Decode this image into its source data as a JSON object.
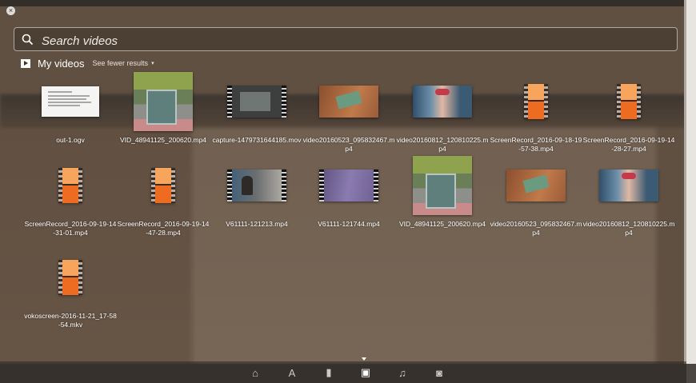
{
  "window": {
    "close_glyph": "×"
  },
  "search": {
    "placeholder": "Search videos",
    "value": ""
  },
  "category": {
    "name": "My videos",
    "toggle_label": "See fewer results",
    "toggle_chevron": "▾"
  },
  "results": [
    {
      "label": "out-1.ogv",
      "kind": "document"
    },
    {
      "label": "VID_48941125_200620.mp4",
      "kind": "photo-board"
    },
    {
      "label": "capture-1479731644185.mov",
      "kind": "screen-strip"
    },
    {
      "label": "video20160523_095832467.mp4",
      "kind": "board"
    },
    {
      "label": "video20160812_120810225.mp4",
      "kind": "child"
    },
    {
      "label": "ScreenRecord_2016-09-18-19-57-38.mp4",
      "kind": "film"
    },
    {
      "label": "ScreenRecord_2016-09-19-14-28-27.mp4",
      "kind": "film"
    },
    {
      "label": "ScreenRecord_2016-09-19-14-31-01.mp4",
      "kind": "film"
    },
    {
      "label": "ScreenRecord_2016-09-19-14-47-28.mp4",
      "kind": "film"
    },
    {
      "label": "V61111-121213.mp4",
      "kind": "person-strip"
    },
    {
      "label": "V61111-121744.mp4",
      "kind": "purple-strip"
    },
    {
      "label": "VID_48941125_200620.mp4",
      "kind": "photo-board"
    },
    {
      "label": "video20160523_095832467.mp4",
      "kind": "board"
    },
    {
      "label": "video20160812_120810225.mp4",
      "kind": "child"
    },
    {
      "label": "vokoscreen-2016-11-21_17-58-54.mkv",
      "kind": "film"
    }
  ],
  "dock": {
    "icons": [
      "home-icon",
      "applications-icon",
      "files-icon",
      "videos-icon",
      "music-icon",
      "photos-icon"
    ],
    "active": "videos-icon"
  }
}
